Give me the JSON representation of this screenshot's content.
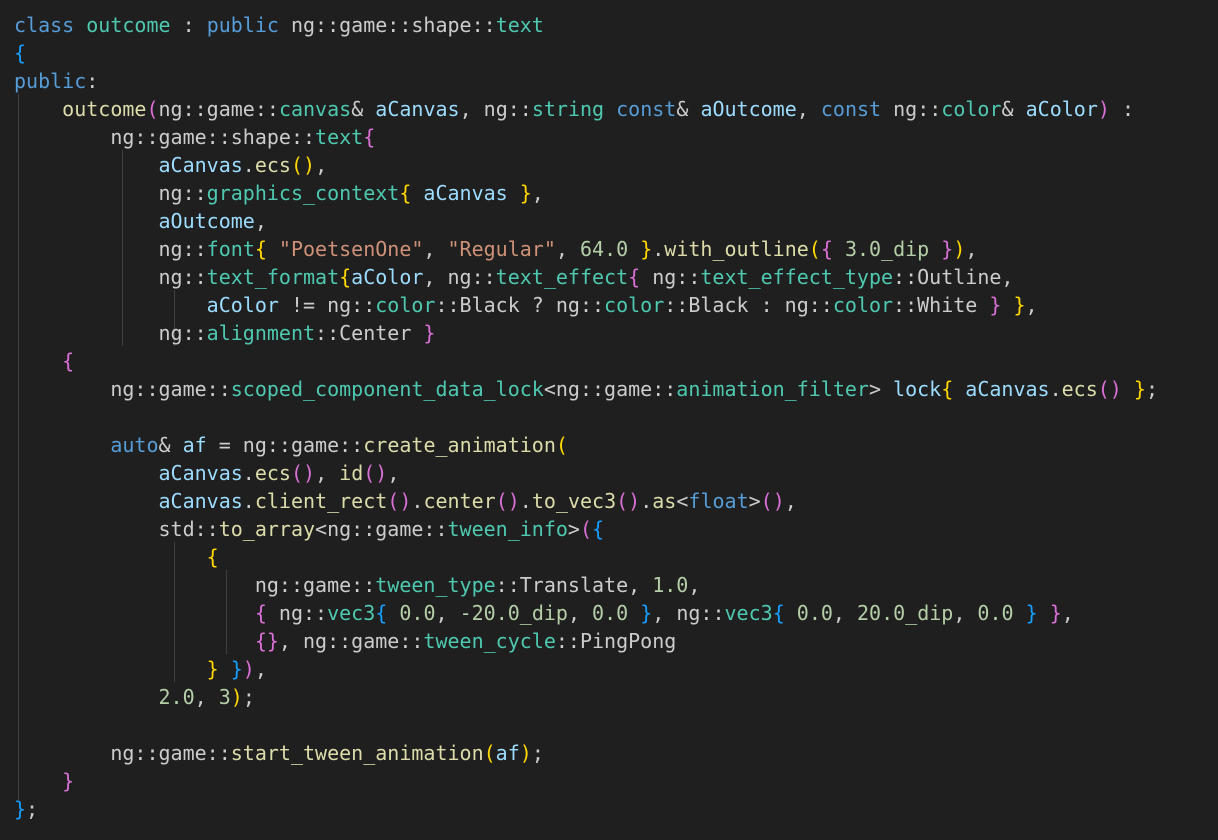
{
  "editor": {
    "background": "#1f1f1f",
    "font_size": 20,
    "line_height": 28,
    "colors": {
      "kw": "#569cd6",
      "type": "#4ec9b0",
      "fn": "#dcdcaa",
      "var": "#9cdcfe",
      "str": "#ce9178",
      "num": "#b5cea8",
      "punc": "#cccccc",
      "br1": "#ffd700",
      "br2": "#da70d6",
      "br3": "#179fff"
    },
    "lines": [
      [
        [
          "kw",
          "class"
        ],
        [
          "punc",
          " "
        ],
        [
          "type",
          "outcome"
        ],
        [
          "punc",
          " : "
        ],
        [
          "kw",
          "public"
        ],
        [
          "punc",
          " ng::game::shape::"
        ],
        [
          "type",
          "text"
        ]
      ],
      [
        [
          "br3",
          "{"
        ]
      ],
      [
        [
          "kw",
          "public"
        ],
        [
          "punc",
          ":"
        ]
      ],
      [
        [
          "punc",
          "    "
        ],
        [
          "fn",
          "outcome"
        ],
        [
          "br2",
          "("
        ],
        [
          "punc",
          "ng::game::"
        ],
        [
          "type",
          "canvas"
        ],
        [
          "punc",
          "& "
        ],
        [
          "var",
          "aCanvas"
        ],
        [
          "punc",
          ", ng::"
        ],
        [
          "type",
          "string"
        ],
        [
          "punc",
          " "
        ],
        [
          "kw",
          "const"
        ],
        [
          "punc",
          "& "
        ],
        [
          "var",
          "aOutcome"
        ],
        [
          "punc",
          ", "
        ],
        [
          "kw",
          "const"
        ],
        [
          "punc",
          " ng::"
        ],
        [
          "type",
          "color"
        ],
        [
          "punc",
          "& "
        ],
        [
          "var",
          "aColor"
        ],
        [
          "br2",
          ")"
        ],
        [
          "punc",
          " :"
        ]
      ],
      [
        [
          "punc",
          "        ng::game::shape::"
        ],
        [
          "type",
          "text"
        ],
        [
          "br2",
          "{"
        ]
      ],
      [
        [
          "punc",
          "            "
        ],
        [
          "var",
          "aCanvas"
        ],
        [
          "punc",
          "."
        ],
        [
          "fn",
          "ecs"
        ],
        [
          "br1",
          "()"
        ],
        [
          "punc",
          ","
        ]
      ],
      [
        [
          "punc",
          "            ng::"
        ],
        [
          "type",
          "graphics_context"
        ],
        [
          "br1",
          "{"
        ],
        [
          "punc",
          " "
        ],
        [
          "var",
          "aCanvas"
        ],
        [
          "punc",
          " "
        ],
        [
          "br1",
          "}"
        ],
        [
          "punc",
          ","
        ]
      ],
      [
        [
          "punc",
          "            "
        ],
        [
          "var",
          "aOutcome"
        ],
        [
          "punc",
          ","
        ]
      ],
      [
        [
          "punc",
          "            ng::"
        ],
        [
          "type",
          "font"
        ],
        [
          "br1",
          "{"
        ],
        [
          "punc",
          " "
        ],
        [
          "str",
          "\"PoetsenOne\""
        ],
        [
          "punc",
          ", "
        ],
        [
          "str",
          "\"Regular\""
        ],
        [
          "punc",
          ", "
        ],
        [
          "num",
          "64.0"
        ],
        [
          "punc",
          " "
        ],
        [
          "br1",
          "}"
        ],
        [
          "punc",
          "."
        ],
        [
          "fn",
          "with_outline"
        ],
        [
          "br1",
          "("
        ],
        [
          "br2",
          "{"
        ],
        [
          "punc",
          " "
        ],
        [
          "num",
          "3.0_dip"
        ],
        [
          "punc",
          " "
        ],
        [
          "br2",
          "}"
        ],
        [
          "br1",
          ")"
        ],
        [
          "punc",
          ","
        ]
      ],
      [
        [
          "punc",
          "            ng::"
        ],
        [
          "type",
          "text_format"
        ],
        [
          "br1",
          "{"
        ],
        [
          "var",
          "aColor"
        ],
        [
          "punc",
          ", ng::"
        ],
        [
          "type",
          "text_effect"
        ],
        [
          "br2",
          "{"
        ],
        [
          "punc",
          " ng::"
        ],
        [
          "type",
          "text_effect_type"
        ],
        [
          "punc",
          "::Outline,"
        ]
      ],
      [
        [
          "punc",
          "                "
        ],
        [
          "var",
          "aColor"
        ],
        [
          "punc",
          " != ng::"
        ],
        [
          "type",
          "color"
        ],
        [
          "punc",
          "::Black ? ng::"
        ],
        [
          "type",
          "color"
        ],
        [
          "punc",
          "::Black : ng::"
        ],
        [
          "type",
          "color"
        ],
        [
          "punc",
          "::White "
        ],
        [
          "br2",
          "}"
        ],
        [
          "punc",
          " "
        ],
        [
          "br1",
          "}"
        ],
        [
          "punc",
          ","
        ]
      ],
      [
        [
          "punc",
          "            ng::"
        ],
        [
          "type",
          "alignment"
        ],
        [
          "punc",
          "::Center "
        ],
        [
          "br2",
          "}"
        ]
      ],
      [
        [
          "punc",
          "    "
        ],
        [
          "br2",
          "{"
        ]
      ],
      [
        [
          "punc",
          "        ng::game::"
        ],
        [
          "type",
          "scoped_component_data_lock"
        ],
        [
          "punc",
          "<ng::game::"
        ],
        [
          "type",
          "animation_filter"
        ],
        [
          "punc",
          "> "
        ],
        [
          "var",
          "lock"
        ],
        [
          "br1",
          "{"
        ],
        [
          "punc",
          " "
        ],
        [
          "var",
          "aCanvas"
        ],
        [
          "punc",
          "."
        ],
        [
          "fn",
          "ecs"
        ],
        [
          "br2",
          "()"
        ],
        [
          "punc",
          " "
        ],
        [
          "br1",
          "}"
        ],
        [
          "punc",
          ";"
        ]
      ],
      [],
      [
        [
          "punc",
          "        "
        ],
        [
          "kw",
          "auto"
        ],
        [
          "punc",
          "& "
        ],
        [
          "var",
          "af"
        ],
        [
          "punc",
          " = ng::game::"
        ],
        [
          "fn",
          "create_animation"
        ],
        [
          "br1",
          "("
        ]
      ],
      [
        [
          "punc",
          "            "
        ],
        [
          "var",
          "aCanvas"
        ],
        [
          "punc",
          "."
        ],
        [
          "fn",
          "ecs"
        ],
        [
          "br2",
          "()"
        ],
        [
          "punc",
          ", "
        ],
        [
          "fn",
          "id"
        ],
        [
          "br2",
          "()"
        ],
        [
          "punc",
          ","
        ]
      ],
      [
        [
          "punc",
          "            "
        ],
        [
          "var",
          "aCanvas"
        ],
        [
          "punc",
          "."
        ],
        [
          "fn",
          "client_rect"
        ],
        [
          "br2",
          "()"
        ],
        [
          "punc",
          "."
        ],
        [
          "fn",
          "center"
        ],
        [
          "br2",
          "()"
        ],
        [
          "punc",
          "."
        ],
        [
          "fn",
          "to_vec3"
        ],
        [
          "br2",
          "()"
        ],
        [
          "punc",
          "."
        ],
        [
          "fn",
          "as"
        ],
        [
          "punc",
          "<"
        ],
        [
          "kw",
          "float"
        ],
        [
          "punc",
          ">"
        ],
        [
          "br2",
          "()"
        ],
        [
          "punc",
          ","
        ]
      ],
      [
        [
          "punc",
          "            std::"
        ],
        [
          "fn",
          "to_array"
        ],
        [
          "punc",
          "<ng::game::"
        ],
        [
          "type",
          "tween_info"
        ],
        [
          "punc",
          ">"
        ],
        [
          "br2",
          "("
        ],
        [
          "br3",
          "{"
        ]
      ],
      [
        [
          "punc",
          "                "
        ],
        [
          "br1",
          "{"
        ]
      ],
      [
        [
          "punc",
          "                    ng::game::"
        ],
        [
          "type",
          "tween_type"
        ],
        [
          "punc",
          "::Translate, "
        ],
        [
          "num",
          "1.0"
        ],
        [
          "punc",
          ","
        ]
      ],
      [
        [
          "punc",
          "                    "
        ],
        [
          "br2",
          "{"
        ],
        [
          "punc",
          " ng::"
        ],
        [
          "type",
          "vec3"
        ],
        [
          "br3",
          "{"
        ],
        [
          "punc",
          " "
        ],
        [
          "num",
          "0.0"
        ],
        [
          "punc",
          ", "
        ],
        [
          "num",
          "-20.0_dip"
        ],
        [
          "punc",
          ", "
        ],
        [
          "num",
          "0.0"
        ],
        [
          "punc",
          " "
        ],
        [
          "br3",
          "}"
        ],
        [
          "punc",
          ", ng::"
        ],
        [
          "type",
          "vec3"
        ],
        [
          "br3",
          "{"
        ],
        [
          "punc",
          " "
        ],
        [
          "num",
          "0.0"
        ],
        [
          "punc",
          ", "
        ],
        [
          "num",
          "20.0_dip"
        ],
        [
          "punc",
          ", "
        ],
        [
          "num",
          "0.0"
        ],
        [
          "punc",
          " "
        ],
        [
          "br3",
          "}"
        ],
        [
          "punc",
          " "
        ],
        [
          "br2",
          "}"
        ],
        [
          "punc",
          ","
        ]
      ],
      [
        [
          "punc",
          "                    "
        ],
        [
          "br2",
          "{}"
        ],
        [
          "punc",
          ", ng::game::"
        ],
        [
          "type",
          "tween_cycle"
        ],
        [
          "punc",
          "::PingPong"
        ]
      ],
      [
        [
          "punc",
          "                "
        ],
        [
          "br1",
          "}"
        ],
        [
          "punc",
          " "
        ],
        [
          "br3",
          "}"
        ],
        [
          "br2",
          ")"
        ],
        [
          "punc",
          ","
        ]
      ],
      [
        [
          "punc",
          "            "
        ],
        [
          "num",
          "2.0"
        ],
        [
          "punc",
          ", "
        ],
        [
          "num",
          "3"
        ],
        [
          "br1",
          ")"
        ],
        [
          "punc",
          ";"
        ]
      ],
      [],
      [
        [
          "punc",
          "        ng::game::"
        ],
        [
          "fn",
          "start_tween_animation"
        ],
        [
          "br1",
          "("
        ],
        [
          "var",
          "af"
        ],
        [
          "br1",
          ")"
        ],
        [
          "punc",
          ";"
        ]
      ],
      [
        [
          "punc",
          "    "
        ],
        [
          "br2",
          "}"
        ]
      ],
      [
        [
          "br3",
          "}"
        ],
        [
          "punc",
          ";"
        ]
      ]
    ]
  }
}
